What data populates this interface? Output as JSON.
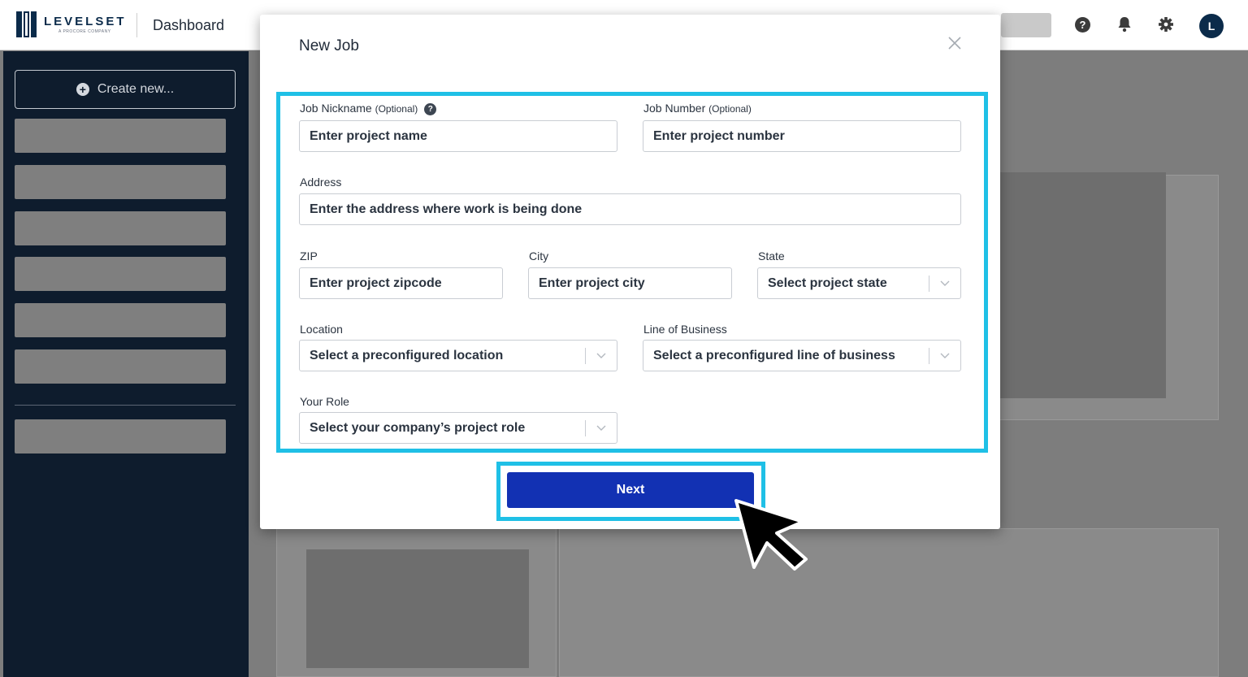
{
  "header": {
    "logo_text": "LEVELSET",
    "logo_subtext": "A PROCORE COMPANY",
    "title": "Dashboard",
    "avatar_initial": "L",
    "icons": [
      "help-icon",
      "bell-icon",
      "gear-icon"
    ]
  },
  "sidebar": {
    "create_label": "Create new...",
    "create_icon": "plus-circle-icon"
  },
  "modal": {
    "title": "New Job",
    "close_icon": "close-icon",
    "fields": {
      "job_nickname": {
        "label": "Job Nickname",
        "optional": "(Optional)",
        "placeholder": "Enter project name"
      },
      "job_number": {
        "label": "Job Number",
        "optional": "(Optional)",
        "placeholder": "Enter project number"
      },
      "address": {
        "label": "Address",
        "placeholder": "Enter the address where work is being done"
      },
      "zip": {
        "label": "ZIP",
        "placeholder": "Enter project zipcode"
      },
      "city": {
        "label": "City",
        "placeholder": "Enter project city"
      },
      "state": {
        "label": "State",
        "value": "Select project state"
      },
      "location": {
        "label": "Location",
        "value": "Select a preconfigured location"
      },
      "line_of_business": {
        "label": "Line of Business",
        "value": "Select a preconfigured line of business"
      },
      "your_role": {
        "label": "Your Role",
        "value": "Select your company’s project role"
      }
    },
    "next_label": "Next"
  },
  "colors": {
    "highlight": "#1fc0e6",
    "primary_button": "#1231b3",
    "sidebar_bg": "#0e1c2d"
  }
}
